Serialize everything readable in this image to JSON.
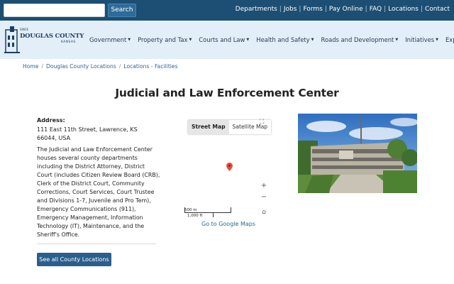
{
  "search": {
    "placeholder": "",
    "button_label": "Search"
  },
  "utility_links": [
    "Departments",
    "Jobs",
    "Forms",
    "Pay Online",
    "FAQ",
    "Locations",
    "Contact"
  ],
  "logo": {
    "small_text": "SINCE",
    "title": "DOUGLAS COUNTY",
    "subtitle": "KANSAS"
  },
  "nav": {
    "items": [
      {
        "label": "Government"
      },
      {
        "label": "Property and Tax"
      },
      {
        "label": "Courts and Law"
      },
      {
        "label": "Health and Safety"
      },
      {
        "label": "Roads and Development"
      },
      {
        "label": "Initiatives"
      },
      {
        "label": "Explore"
      }
    ]
  },
  "breadcrumb": [
    "Home",
    "Douglas County Locations",
    "Locations - Facilities"
  ],
  "page": {
    "title": "Judicial and Law Enforcement Center",
    "address_label": "Address:",
    "address": "111 East 11th Street, Lawrence, KS 66044, USA",
    "description": "The Judicial and Law Enforcement Center houses several county departments including the District Attorney, District Court (includes Citizen Review Board (CRB), Clerk of the District Court, Community Corrections, Court Services, Court Trustee and Divisions 1-7, Juvenile and Pro Tem), Emergency Communications (911), Emergency Management, Information Technology (IT), Maintenance, and the Sheriff's Office.",
    "locations_button": "See all County Locations"
  },
  "map": {
    "street_map_label": "Street Map",
    "satellite_label": "Satellite Map",
    "zoom_in": "+",
    "zoom_out": "−",
    "scale_top": "500 m",
    "scale_bottom": "1,000 ft",
    "google_link": "Go to Google Maps",
    "pin_color": "#e74c3c"
  },
  "colors": {
    "topbar": "#1d4e74",
    "navbar": "#e2eef8",
    "link": "#2b6690",
    "button": "#2a5f8c"
  }
}
